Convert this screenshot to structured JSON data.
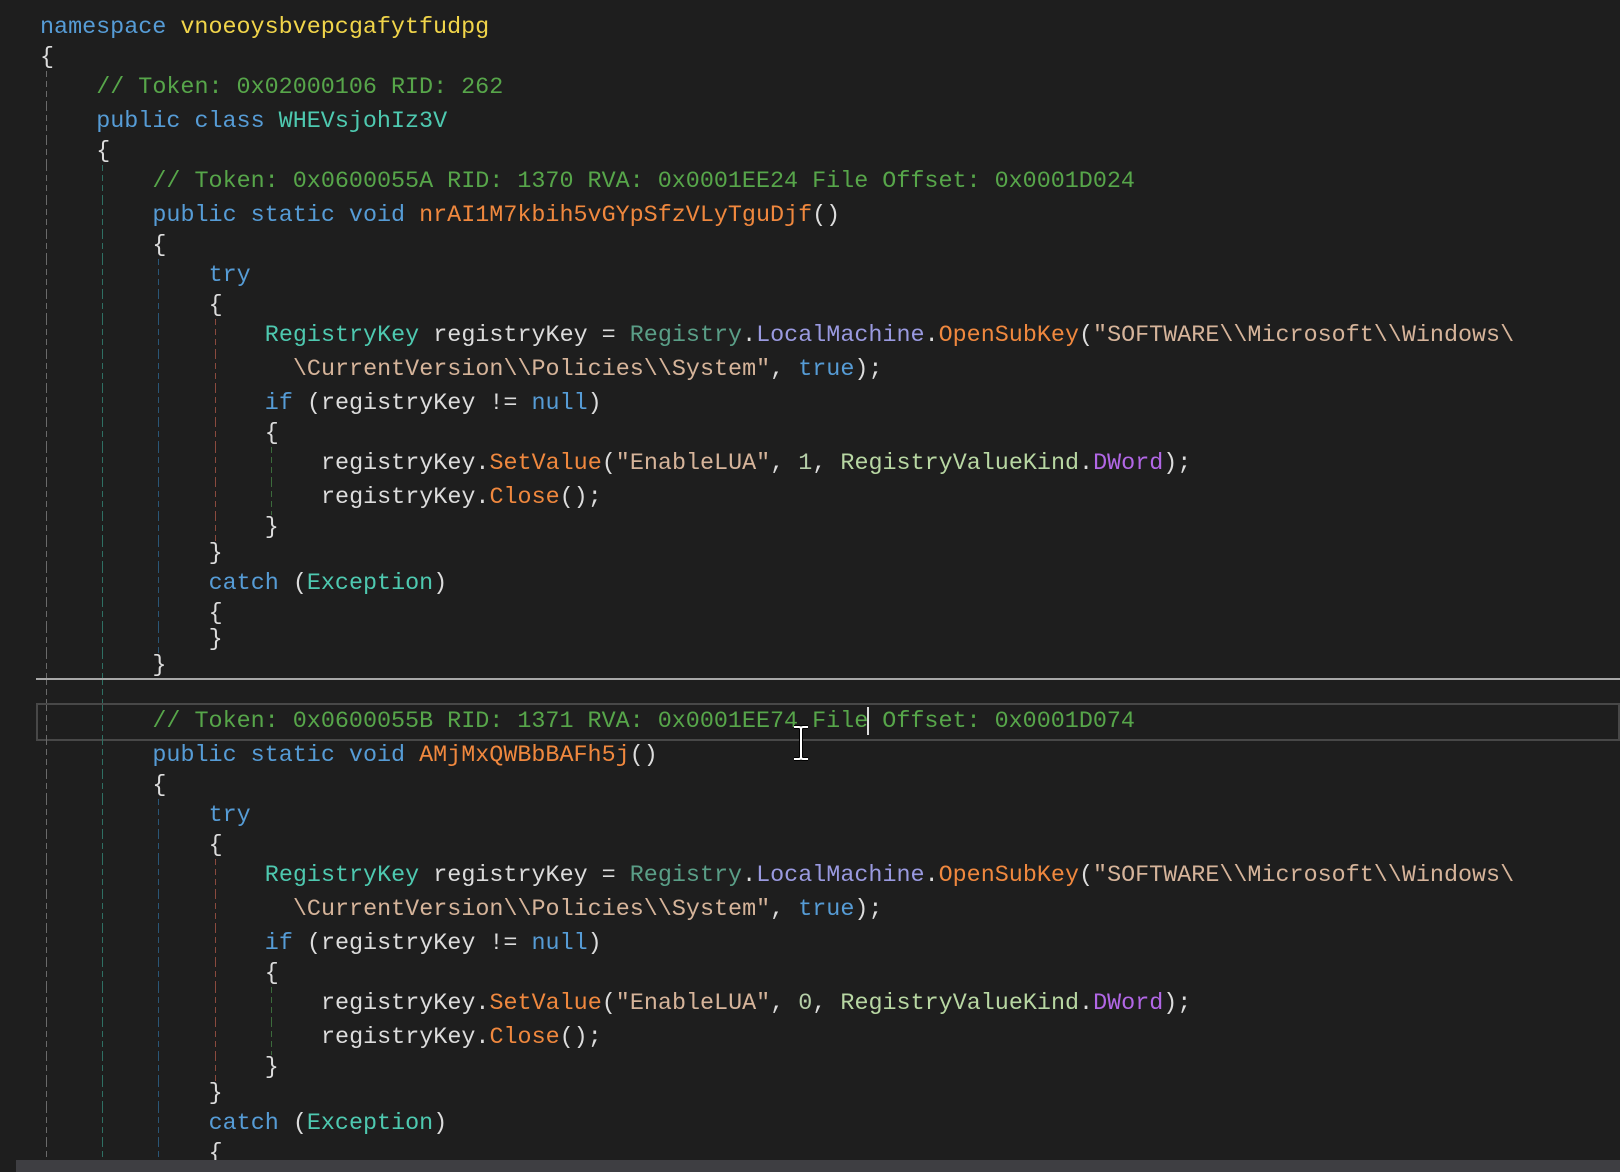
{
  "colors": {
    "background": "#1e1e1e",
    "keyword": "#569cd6",
    "comment": "#57a64a",
    "type": "#4ec9b0",
    "method": "#f0883e",
    "string": "#d6b49a"
  },
  "code": {
    "lines": [
      {
        "indent": 0,
        "tokens": [
          {
            "t": "namespace ",
            "k": "kw"
          },
          {
            "t": "vnoeoysbvepcgafytfudpg",
            "k": "ns"
          }
        ]
      },
      {
        "indent": 0,
        "compact": true,
        "tokens": [
          {
            "t": "{",
            "k": "plain"
          }
        ]
      },
      {
        "indent": 1,
        "tokens": [
          {
            "t": "// Token: 0x02000106 RID: 262",
            "k": "cm"
          }
        ]
      },
      {
        "indent": 1,
        "tokens": [
          {
            "t": "public class ",
            "k": "kw"
          },
          {
            "t": "WHEVsjohIz3V",
            "k": "type"
          }
        ]
      },
      {
        "indent": 1,
        "compact": true,
        "tokens": [
          {
            "t": "{",
            "k": "plain"
          }
        ]
      },
      {
        "indent": 2,
        "tokens": [
          {
            "t": "// Token: 0x0600055A RID: 1370 RVA: 0x0001EE24 File Offset: 0x0001D024",
            "k": "cm"
          }
        ]
      },
      {
        "indent": 2,
        "tokens": [
          {
            "t": "public static void ",
            "k": "kw"
          },
          {
            "t": "nrAI1M7kbih5vGYpSfzVLyTguDjf",
            "k": "method"
          },
          {
            "t": "()",
            "k": "plain"
          }
        ]
      },
      {
        "indent": 2,
        "compact": true,
        "tokens": [
          {
            "t": "{",
            "k": "plain"
          }
        ]
      },
      {
        "indent": 3,
        "tokens": [
          {
            "t": "try",
            "k": "kw"
          }
        ]
      },
      {
        "indent": 3,
        "compact": true,
        "tokens": [
          {
            "t": "{",
            "k": "plain"
          }
        ]
      },
      {
        "indent": 4,
        "tokens": [
          {
            "t": "RegistryKey",
            "k": "type"
          },
          {
            "t": " registryKey = ",
            "k": "plain"
          },
          {
            "t": "Registry",
            "k": "cls"
          },
          {
            "t": ".",
            "k": "plain"
          },
          {
            "t": "LocalMachine",
            "k": "prop"
          },
          {
            "t": ".",
            "k": "plain"
          },
          {
            "t": "OpenSubKey",
            "k": "method"
          },
          {
            "t": "(",
            "k": "plain"
          },
          {
            "t": "\"SOFTWARE\\\\Microsoft\\\\Windows\\",
            "k": "str"
          }
        ]
      },
      {
        "indent": 4,
        "wrap": true,
        "tokens": [
          {
            "t": "\\CurrentVersion\\\\Policies\\\\System\"",
            "k": "str"
          },
          {
            "t": ", ",
            "k": "plain"
          },
          {
            "t": "true",
            "k": "kw"
          },
          {
            "t": ");",
            "k": "plain"
          }
        ]
      },
      {
        "indent": 4,
        "tokens": [
          {
            "t": "if",
            "k": "kw"
          },
          {
            "t": " (registryKey != ",
            "k": "plain"
          },
          {
            "t": "null",
            "k": "kw"
          },
          {
            "t": ")",
            "k": "plain"
          }
        ]
      },
      {
        "indent": 4,
        "compact": true,
        "tokens": [
          {
            "t": "{",
            "k": "plain"
          }
        ]
      },
      {
        "indent": 5,
        "tokens": [
          {
            "t": "registryKey.",
            "k": "plain"
          },
          {
            "t": "SetValue",
            "k": "method"
          },
          {
            "t": "(",
            "k": "plain"
          },
          {
            "t": "\"EnableLUA\"",
            "k": "str"
          },
          {
            "t": ", ",
            "k": "plain"
          },
          {
            "t": "1",
            "k": "num"
          },
          {
            "t": ", ",
            "k": "plain"
          },
          {
            "t": "RegistryValueKind",
            "k": "enum"
          },
          {
            "t": ".",
            "k": "plain"
          },
          {
            "t": "DWord",
            "k": "enumval"
          },
          {
            "t": ");",
            "k": "plain"
          }
        ]
      },
      {
        "indent": 5,
        "tokens": [
          {
            "t": "registryKey.",
            "k": "plain"
          },
          {
            "t": "Close",
            "k": "method"
          },
          {
            "t": "();",
            "k": "plain"
          }
        ]
      },
      {
        "indent": 4,
        "compact": true,
        "tokens": [
          {
            "t": "}",
            "k": "plain"
          }
        ]
      },
      {
        "indent": 3,
        "compact": true,
        "tokens": [
          {
            "t": "}",
            "k": "plain"
          }
        ]
      },
      {
        "indent": 3,
        "tokens": [
          {
            "t": "catch",
            "k": "kw"
          },
          {
            "t": " (",
            "k": "plain"
          },
          {
            "t": "Exception",
            "k": "type"
          },
          {
            "t": ")",
            "k": "plain"
          }
        ]
      },
      {
        "indent": 3,
        "compact": true,
        "tokens": [
          {
            "t": "{",
            "k": "plain"
          }
        ]
      },
      {
        "indent": 3,
        "compact": true,
        "tokens": [
          {
            "t": "}",
            "k": "plain"
          }
        ]
      },
      {
        "indent": 2,
        "compact": true,
        "tokens": [
          {
            "t": "}",
            "k": "plain"
          }
        ]
      },
      {
        "indent": 2,
        "compact": true,
        "separator": true,
        "tokens": []
      },
      {
        "indent": 2,
        "current": true,
        "tokens": [
          {
            "t": "// Token: 0x0600055B RID: 1371 RVA: 0x0001EE74 File",
            "k": "cm",
            "caret": true
          },
          {
            "t": " Offset: 0x0001D074",
            "k": "cm"
          }
        ]
      },
      {
        "indent": 2,
        "tokens": [
          {
            "t": "public static void ",
            "k": "kw"
          },
          {
            "t": "AMjMxQWBbBAFh5j",
            "k": "method"
          },
          {
            "t": "()",
            "k": "plain"
          }
        ]
      },
      {
        "indent": 2,
        "compact": true,
        "tokens": [
          {
            "t": "{",
            "k": "plain"
          }
        ]
      },
      {
        "indent": 3,
        "tokens": [
          {
            "t": "try",
            "k": "kw"
          }
        ]
      },
      {
        "indent": 3,
        "compact": true,
        "tokens": [
          {
            "t": "{",
            "k": "plain"
          }
        ]
      },
      {
        "indent": 4,
        "tokens": [
          {
            "t": "RegistryKey",
            "k": "type"
          },
          {
            "t": " registryKey = ",
            "k": "plain"
          },
          {
            "t": "Registry",
            "k": "cls"
          },
          {
            "t": ".",
            "k": "plain"
          },
          {
            "t": "LocalMachine",
            "k": "prop"
          },
          {
            "t": ".",
            "k": "plain"
          },
          {
            "t": "OpenSubKey",
            "k": "method"
          },
          {
            "t": "(",
            "k": "plain"
          },
          {
            "t": "\"SOFTWARE\\\\Microsoft\\\\Windows\\",
            "k": "str"
          }
        ]
      },
      {
        "indent": 4,
        "wrap": true,
        "tokens": [
          {
            "t": "\\CurrentVersion\\\\Policies\\\\System\"",
            "k": "str"
          },
          {
            "t": ", ",
            "k": "plain"
          },
          {
            "t": "true",
            "k": "kw"
          },
          {
            "t": ");",
            "k": "plain"
          }
        ]
      },
      {
        "indent": 4,
        "tokens": [
          {
            "t": "if",
            "k": "kw"
          },
          {
            "t": " (registryKey != ",
            "k": "plain"
          },
          {
            "t": "null",
            "k": "kw"
          },
          {
            "t": ")",
            "k": "plain"
          }
        ]
      },
      {
        "indent": 4,
        "compact": true,
        "tokens": [
          {
            "t": "{",
            "k": "plain"
          }
        ]
      },
      {
        "indent": 5,
        "tokens": [
          {
            "t": "registryKey.",
            "k": "plain"
          },
          {
            "t": "SetValue",
            "k": "method"
          },
          {
            "t": "(",
            "k": "plain"
          },
          {
            "t": "\"EnableLUA\"",
            "k": "str"
          },
          {
            "t": ", ",
            "k": "plain"
          },
          {
            "t": "0",
            "k": "num"
          },
          {
            "t": ", ",
            "k": "plain"
          },
          {
            "t": "RegistryValueKind",
            "k": "enum"
          },
          {
            "t": ".",
            "k": "plain"
          },
          {
            "t": "DWord",
            "k": "enumval"
          },
          {
            "t": ");",
            "k": "plain"
          }
        ]
      },
      {
        "indent": 5,
        "tokens": [
          {
            "t": "registryKey.",
            "k": "plain"
          },
          {
            "t": "Close",
            "k": "method"
          },
          {
            "t": "();",
            "k": "plain"
          }
        ]
      },
      {
        "indent": 4,
        "compact": true,
        "tokens": [
          {
            "t": "}",
            "k": "plain"
          }
        ]
      },
      {
        "indent": 3,
        "compact": true,
        "tokens": [
          {
            "t": "}",
            "k": "plain"
          }
        ]
      },
      {
        "indent": 3,
        "tokens": [
          {
            "t": "catch",
            "k": "kw"
          },
          {
            "t": " (",
            "k": "plain"
          },
          {
            "t": "Exception",
            "k": "type"
          },
          {
            "t": ")",
            "k": "plain"
          }
        ]
      },
      {
        "indent": 3,
        "compact": true,
        "tokens": [
          {
            "t": "{",
            "k": "plain"
          }
        ]
      }
    ]
  }
}
